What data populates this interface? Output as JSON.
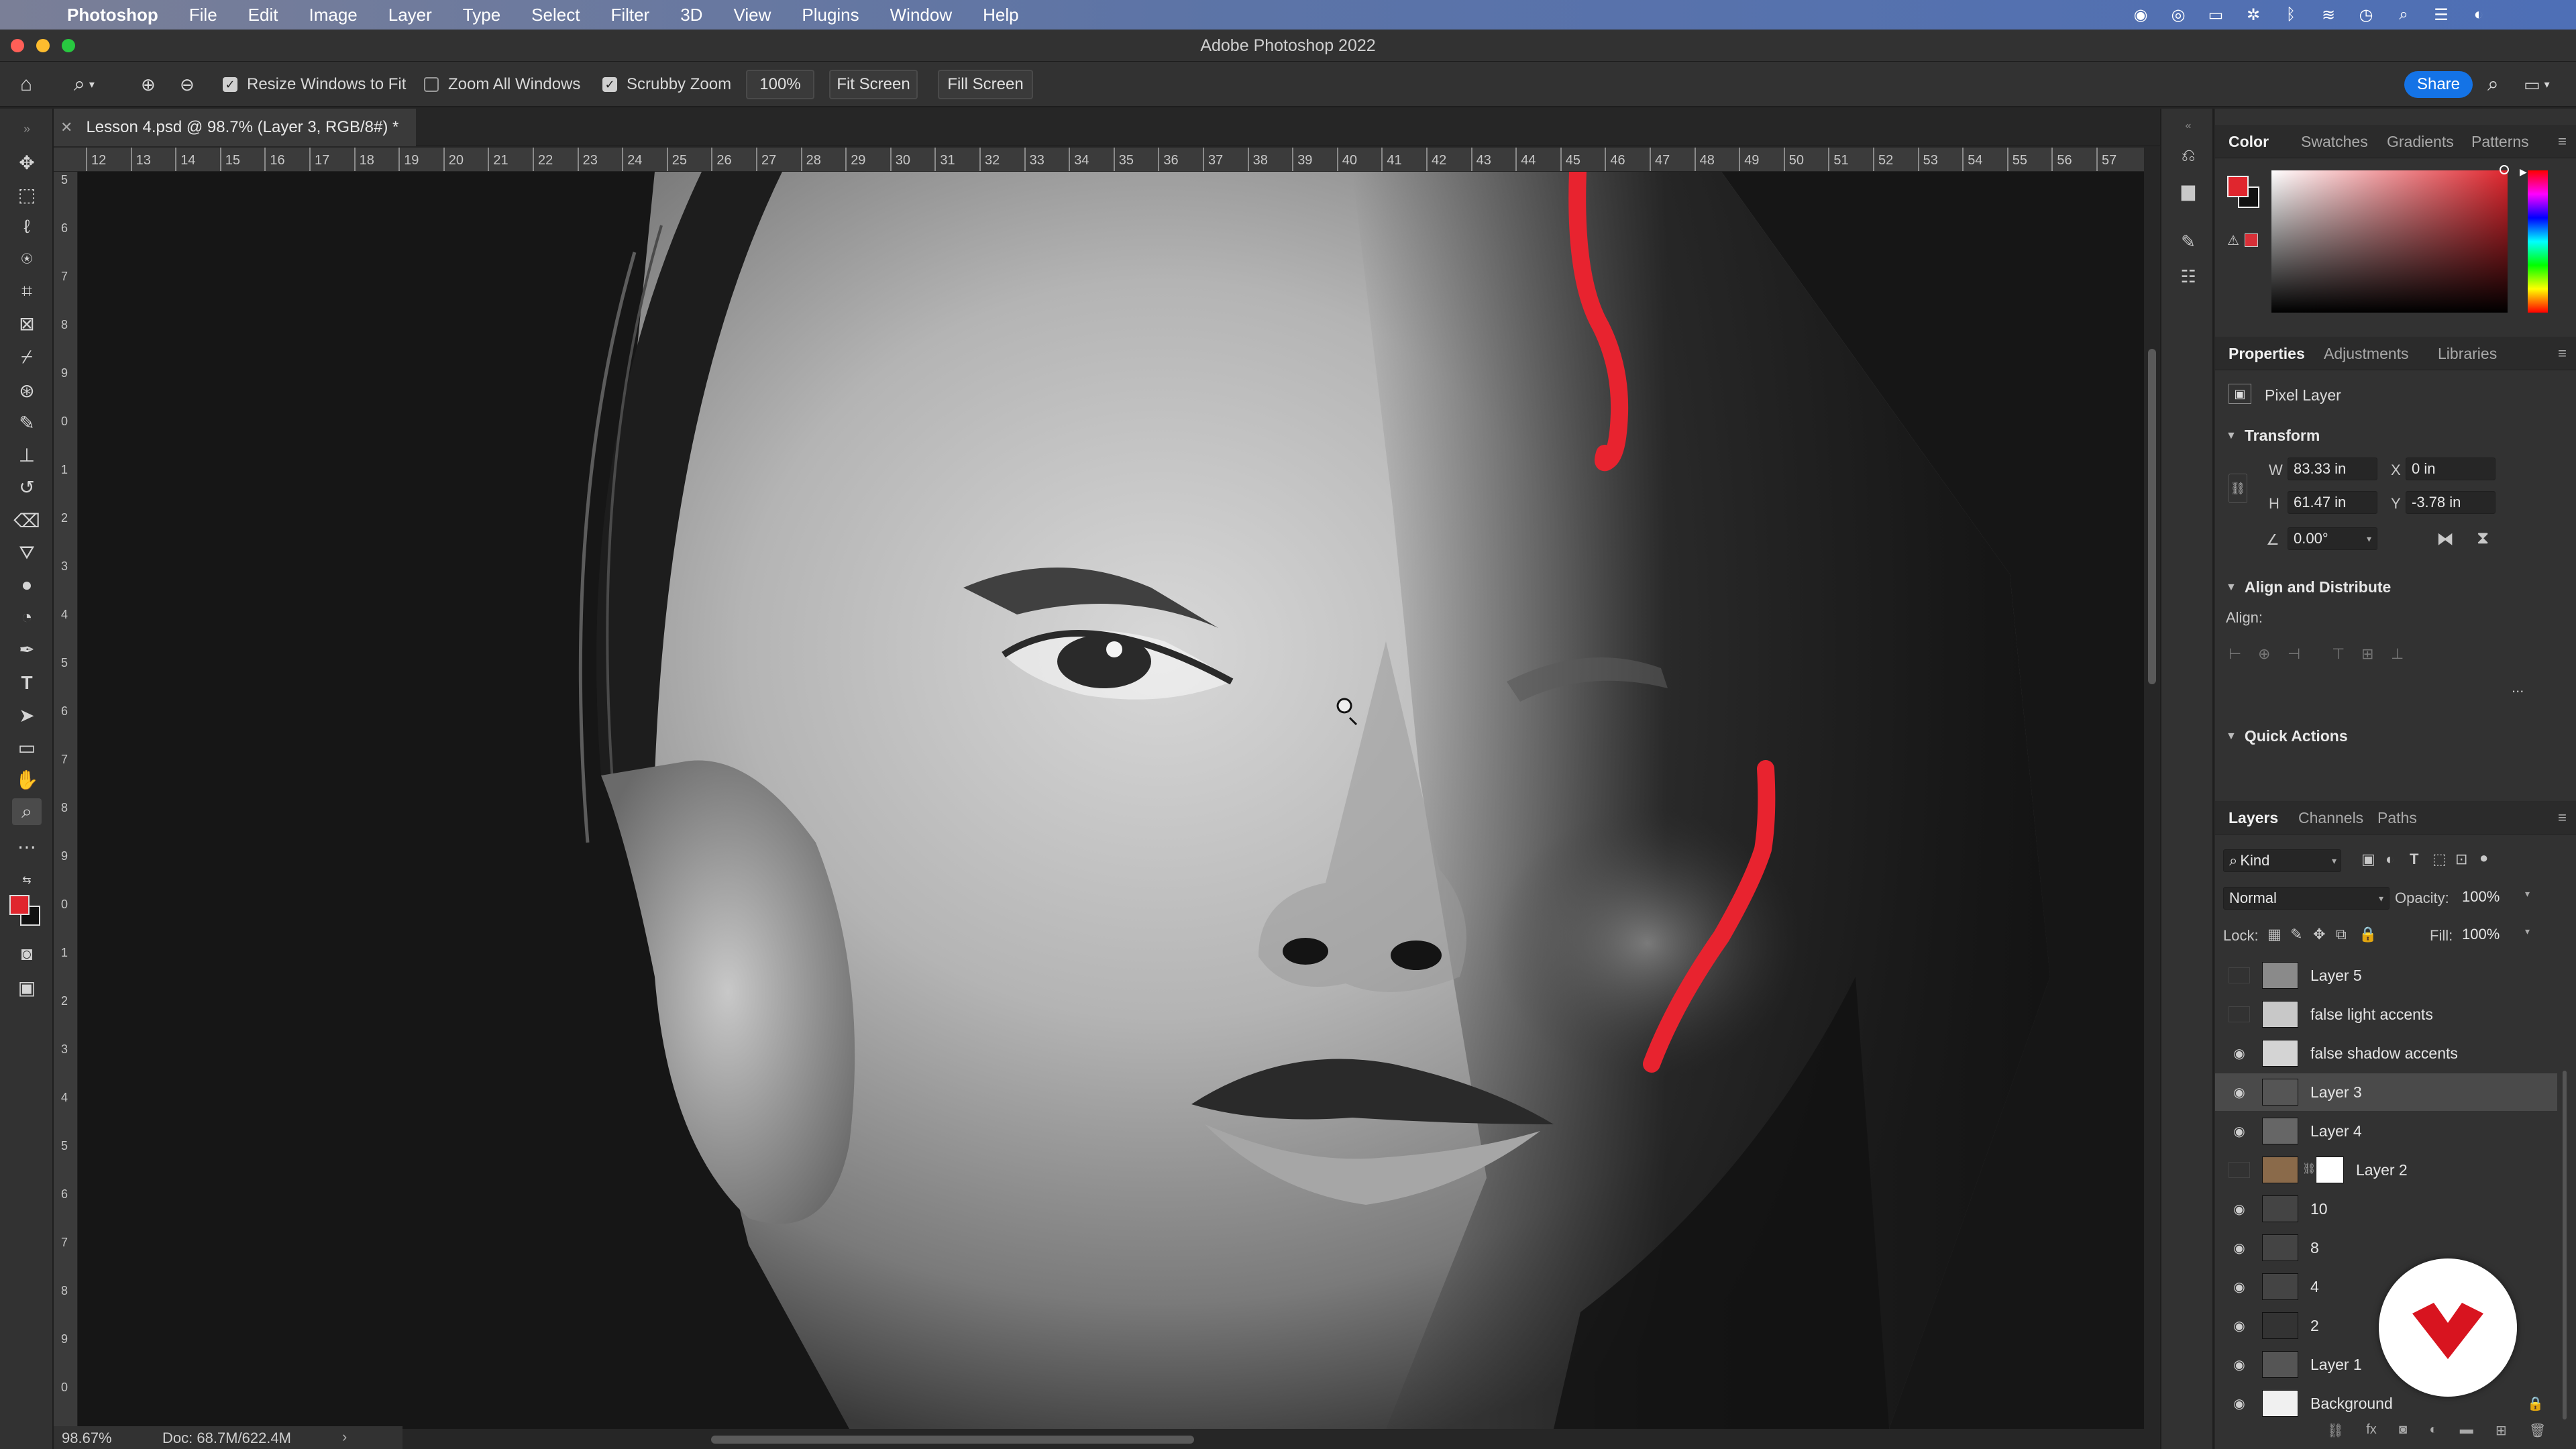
{
  "menubar": {
    "app_name": "Photoshop",
    "items": [
      "File",
      "Edit",
      "Image",
      "Layer",
      "Type",
      "Select",
      "Filter",
      "3D",
      "View",
      "Plugins",
      "Window",
      "Help"
    ]
  },
  "window": {
    "title": "Adobe Photoshop 2022"
  },
  "options": {
    "resize_windows": {
      "label": "Resize Windows to Fit",
      "checked": true
    },
    "zoom_all": {
      "label": "Zoom All Windows",
      "checked": false
    },
    "scrubby": {
      "label": "Scrubby Zoom",
      "checked": true
    },
    "zoom_value": "100%",
    "fit_screen": "Fit Screen",
    "fill_screen": "Fill Screen",
    "share": "Share"
  },
  "document": {
    "tab_title": "Lesson 4.psd @ 98.7% (Layer 3, RGB/8#) *"
  },
  "ruler": {
    "h": [
      "12",
      "13",
      "14",
      "15",
      "16",
      "17",
      "18",
      "19",
      "20",
      "21",
      "22",
      "23",
      "24",
      "25",
      "26",
      "27",
      "28",
      "29",
      "30",
      "31",
      "32",
      "33",
      "34",
      "35",
      "36",
      "37",
      "38",
      "39",
      "40",
      "41",
      "42",
      "43",
      "44",
      "45",
      "46",
      "47",
      "48",
      "49",
      "50",
      "51",
      "52",
      "53",
      "54",
      "55",
      "56",
      "57"
    ],
    "v": [
      "5",
      "6",
      "7",
      "8",
      "9",
      "0",
      "1",
      "2",
      "3",
      "4",
      "5",
      "6",
      "7",
      "8",
      "9",
      "0",
      "1",
      "2",
      "3",
      "4",
      "5",
      "6",
      "7",
      "8",
      "9",
      "0"
    ]
  },
  "status": {
    "zoom": "98.67%",
    "doc": "Doc: 68.7M/622.4M"
  },
  "color_panel": {
    "tabs": [
      "Color",
      "Swatches",
      "Gradients",
      "Patterns"
    ],
    "foreground": "#e0262e",
    "background": "#111111"
  },
  "properties": {
    "tabs": [
      "Properties",
      "Adjustments",
      "Libraries"
    ],
    "kind": "Pixel Layer",
    "transform_title": "Transform",
    "w_label": "W",
    "w": "83.33 in",
    "x_label": "X",
    "x": "0 in",
    "h_label": "H",
    "h": "61.47 in",
    "y_label": "Y",
    "y": "-3.78 in",
    "angle": "0.00°",
    "align_title": "Align and Distribute",
    "align_label": "Align:",
    "more": "...",
    "quick_actions": "Quick Actions"
  },
  "layers_panel": {
    "tabs": [
      "Layers",
      "Channels",
      "Paths"
    ],
    "filter": "Kind",
    "blend_mode": "Normal",
    "opacity_label": "Opacity:",
    "opacity": "100%",
    "lock_label": "Lock:",
    "fill_label": "Fill:",
    "fill": "100%",
    "layers": [
      {
        "name": "Layer 5",
        "visible": false,
        "selected": false
      },
      {
        "name": "false light accents",
        "visible": false,
        "selected": false
      },
      {
        "name": "false shadow accents",
        "visible": true,
        "selected": false
      },
      {
        "name": "Layer 3",
        "visible": true,
        "selected": true
      },
      {
        "name": "Layer 4",
        "visible": true,
        "selected": false
      },
      {
        "name": "Layer 2",
        "visible": false,
        "selected": false,
        "has_mask": true
      },
      {
        "name": "10",
        "visible": true,
        "selected": false
      },
      {
        "name": "8",
        "visible": true,
        "selected": false
      },
      {
        "name": "4",
        "visible": true,
        "selected": false
      },
      {
        "name": "2",
        "visible": true,
        "selected": false
      },
      {
        "name": "Layer 1",
        "visible": true,
        "selected": false
      },
      {
        "name": "Background",
        "visible": true,
        "selected": false,
        "locked": true
      }
    ]
  },
  "colors": {
    "accent": "#1473e6",
    "brush_stroke": "#e8232f",
    "badge": "#d8141f"
  }
}
